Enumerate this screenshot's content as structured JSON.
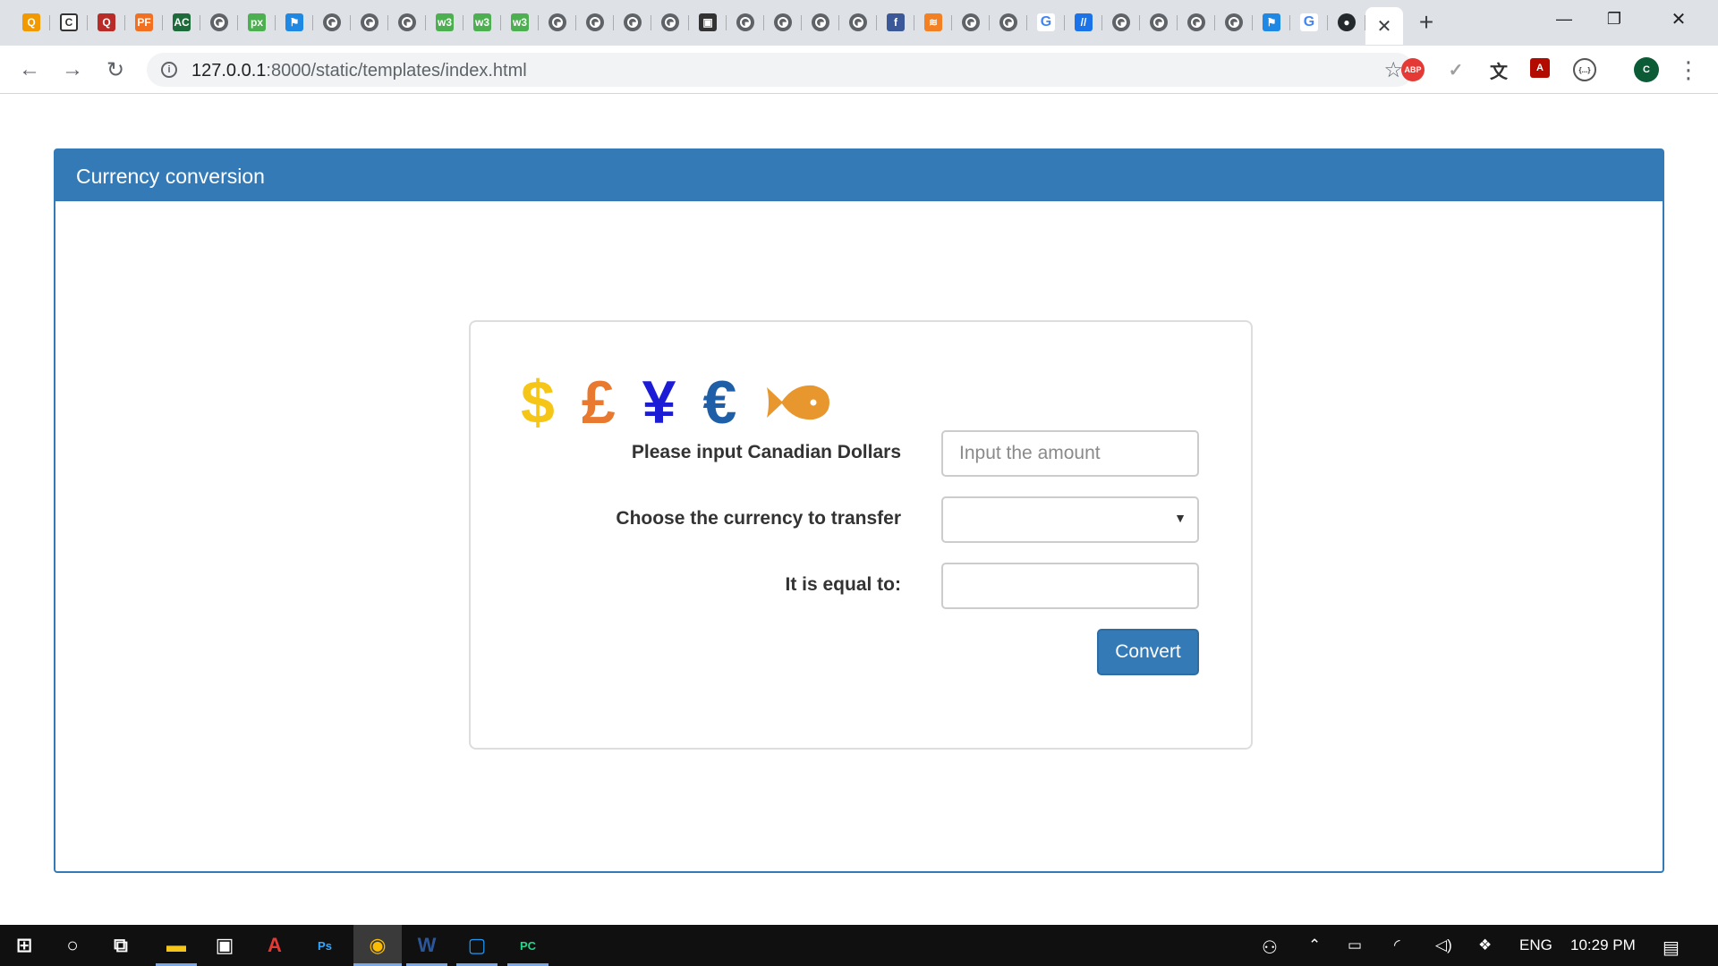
{
  "browser": {
    "pinned_tabs": [
      {
        "icon": "q-search-icon",
        "text": "Q",
        "color": "#f29900"
      },
      {
        "icon": "bracket-c-icon",
        "text": "C",
        "color": "#ffffff"
      },
      {
        "icon": "quora-icon",
        "text": "Q",
        "color": "#b92b27"
      },
      {
        "icon": "pf-icon",
        "text": "PF",
        "color": "#f37021"
      },
      {
        "icon": "ac-icon",
        "text": "AC",
        "color": "#1d6b3a"
      },
      {
        "icon": "globe-icon",
        "text": "",
        "color": "globe"
      },
      {
        "icon": "px-icon",
        "text": "px",
        "color": "#4caf50"
      },
      {
        "icon": "flag-icon",
        "text": "⚑",
        "color": "#1e88e5"
      },
      {
        "icon": "globe-icon",
        "text": "",
        "color": "globe"
      },
      {
        "icon": "globe-icon",
        "text": "",
        "color": "globe"
      },
      {
        "icon": "globe-icon",
        "text": "",
        "color": "globe"
      },
      {
        "icon": "w3-icon",
        "text": "w3",
        "color": "#4caf50"
      },
      {
        "icon": "w3-icon",
        "text": "w3",
        "color": "#4caf50"
      },
      {
        "icon": "w3-icon",
        "text": "w3",
        "color": "#4caf50"
      },
      {
        "icon": "globe-icon",
        "text": "",
        "color": "globe"
      },
      {
        "icon": "globe-icon",
        "text": "",
        "color": "globe"
      },
      {
        "icon": "globe-icon",
        "text": "",
        "color": "globe"
      },
      {
        "icon": "globe-icon",
        "text": "",
        "color": "globe"
      },
      {
        "icon": "image-icon",
        "text": "▣",
        "color": "#333333"
      },
      {
        "icon": "globe-icon",
        "text": "",
        "color": "globe"
      },
      {
        "icon": "globe-icon",
        "text": "",
        "color": "globe"
      },
      {
        "icon": "globe-icon",
        "text": "",
        "color": "globe"
      },
      {
        "icon": "globe-icon",
        "text": "",
        "color": "globe"
      },
      {
        "icon": "facebook-icon",
        "text": "f",
        "color": "#3b5998"
      },
      {
        "icon": "stackoverflow-icon",
        "text": "≋",
        "color": "#f48024"
      },
      {
        "icon": "globe-icon",
        "text": "",
        "color": "globe"
      },
      {
        "icon": "globe-icon",
        "text": "",
        "color": "globe"
      },
      {
        "icon": "google-icon",
        "text": "G",
        "color": "#4285f4"
      },
      {
        "icon": "slash-icon",
        "text": "//",
        "color": "#1a73e8"
      },
      {
        "icon": "globe-icon",
        "text": "",
        "color": "globe"
      },
      {
        "icon": "globe-icon",
        "text": "",
        "color": "globe"
      },
      {
        "icon": "globe-icon",
        "text": "",
        "color": "globe"
      },
      {
        "icon": "globe-icon",
        "text": "",
        "color": "globe"
      },
      {
        "icon": "flag-icon",
        "text": "⚑",
        "color": "#1e88e5"
      },
      {
        "icon": "google-icon",
        "text": "G",
        "color": "#4285f4"
      },
      {
        "icon": "github-icon",
        "text": "●",
        "color": "#24292e"
      }
    ],
    "active_tab_close": "✕",
    "new_tab": "+",
    "window_controls": {
      "minimize": "—",
      "restore": "❐",
      "close": "✕"
    },
    "nav": {
      "back": "←",
      "forward": "→",
      "reload": "↻"
    },
    "url_host": "127.0.0.1",
    "url_rest": ":8000/static/templates/index.html",
    "bookmark_star": "☆",
    "extensions": [
      {
        "name": "adblock-icon",
        "text": "ABP",
        "color": "#e53935"
      },
      {
        "name": "check-icon",
        "text": "✓",
        "color": "#9e9e9e"
      },
      {
        "name": "translate-icon",
        "text": "文",
        "color": "#333333"
      },
      {
        "name": "acrobat-icon",
        "text": "A",
        "color": "#b30b00"
      },
      {
        "name": "json-icon",
        "text": "{...}",
        "color": "#333333"
      },
      {
        "name": "profile-avatar",
        "text": "C",
        "color": "#0b5b36"
      }
    ],
    "menu": "⋮"
  },
  "page": {
    "panel_title": "Currency conversion",
    "symbols": [
      {
        "name": "dollar-icon",
        "char": "$",
        "color": "#f5c518"
      },
      {
        "name": "pound-icon",
        "char": "£",
        "color": "#e8792e"
      },
      {
        "name": "yen-icon",
        "char": "¥",
        "color": "#1c1cd6"
      },
      {
        "name": "euro-icon",
        "char": "€",
        "color": "#1f5fa8"
      }
    ],
    "fish_color": "#e8972e",
    "form": {
      "amount_label": "Please input Canadian Dollars",
      "amount_placeholder": "Input the amount",
      "amount_value": "",
      "currency_label": "Choose the currency to transfer",
      "currency_selected": "",
      "caret": "▼",
      "result_label": "It is equal to:",
      "result_value": "",
      "convert_label": "Convert"
    }
  },
  "taskbar": {
    "apps": [
      {
        "name": "start-button",
        "text": "⊞",
        "color": "#ffffff"
      },
      {
        "name": "cortana-icon",
        "text": "○",
        "color": "#ffffff"
      },
      {
        "name": "task-view-icon",
        "text": "⧉",
        "color": "#ffffff"
      },
      {
        "name": "file-explorer-icon",
        "text": "▬",
        "color": "#f5c518"
      },
      {
        "name": "store-icon",
        "text": "▣",
        "color": "#ffffff"
      },
      {
        "name": "acrobat-taskbar-icon",
        "text": "A",
        "color": "#e53935"
      },
      {
        "name": "photoshop-icon",
        "text": "Ps",
        "color": "#31a8ff"
      },
      {
        "name": "chrome-icon",
        "text": "◉",
        "color": "#fbbc04"
      },
      {
        "name": "word-icon",
        "text": "W",
        "color": "#2b579a"
      },
      {
        "name": "tablet-app-icon",
        "text": "▢",
        "color": "#2196f3"
      },
      {
        "name": "pycharm-icon",
        "text": "PC",
        "color": "#21d789"
      }
    ],
    "tray": {
      "language": "ENG",
      "time": "10:29 PM"
    }
  }
}
